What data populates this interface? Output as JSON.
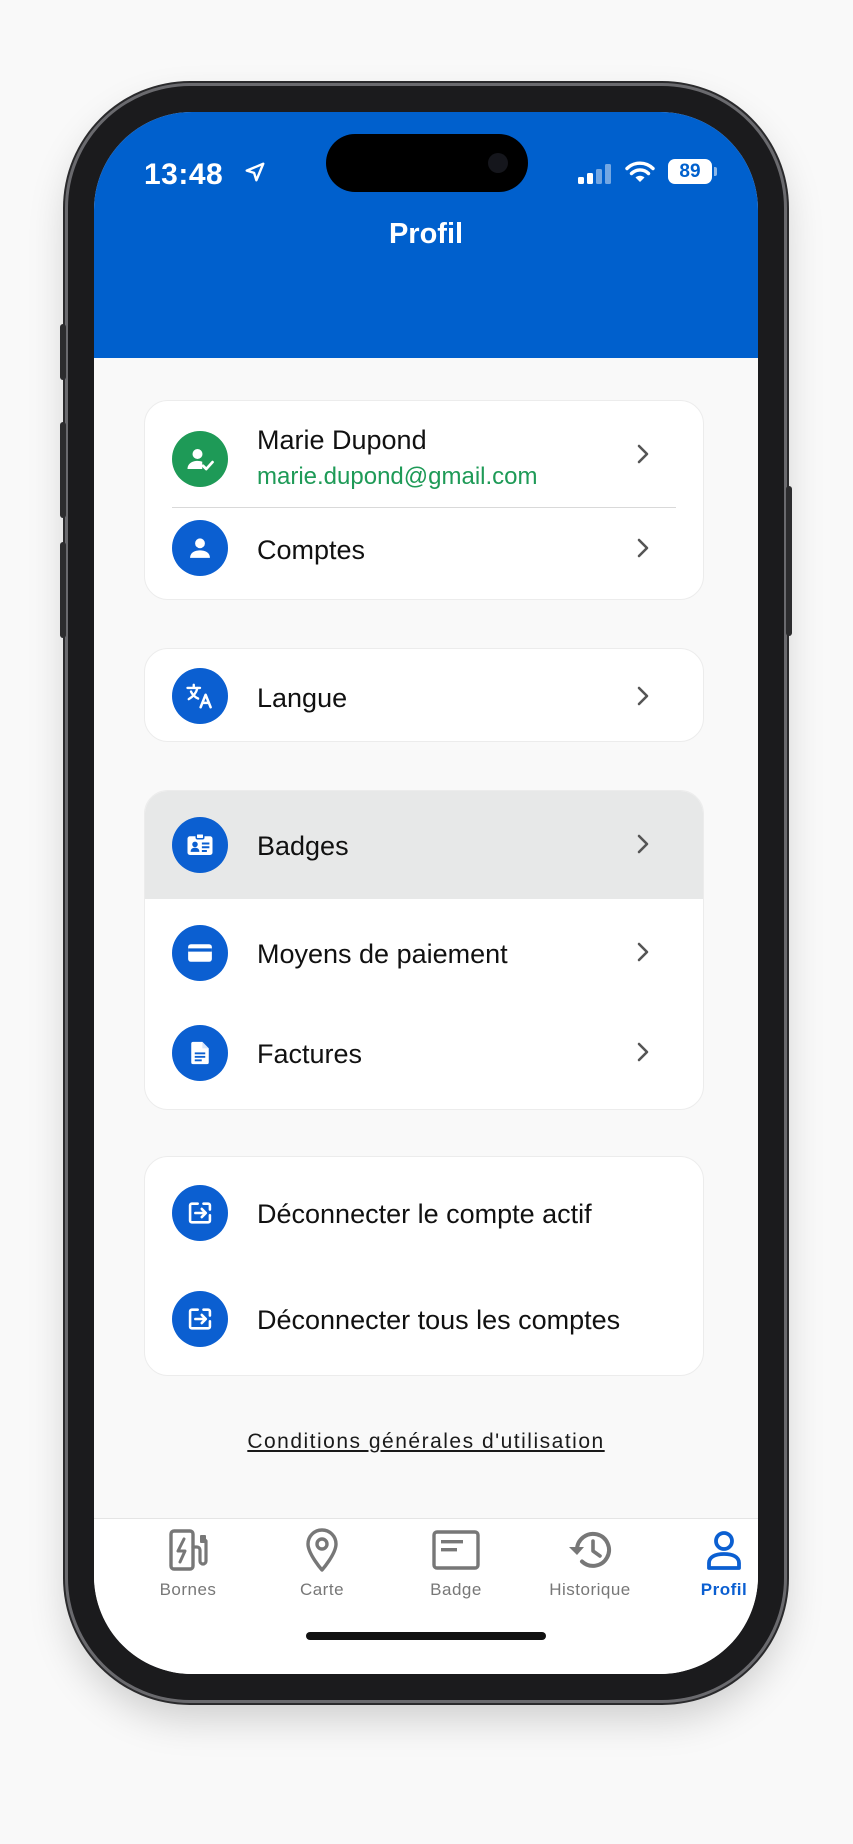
{
  "status_bar": {
    "time": "13:48",
    "battery": "89",
    "location_icon": "location-arrow-icon",
    "signal_icon": "cellular-signal-icon",
    "wifi_icon": "wifi-icon"
  },
  "header": {
    "title": "Profil"
  },
  "profile_card": {
    "user": {
      "name": "Marie Dupond",
      "email": "marie.dupond@gmail.com",
      "icon": "verified-user-icon"
    },
    "accounts": {
      "label": "Comptes",
      "icon": "person-icon"
    }
  },
  "language_card": {
    "label": "Langue",
    "icon": "translate-icon"
  },
  "payment_card": {
    "items": [
      {
        "label": "Badges",
        "icon": "badge-id-icon"
      },
      {
        "label": "Moyens de paiement",
        "icon": "credit-card-icon"
      },
      {
        "label": "Factures",
        "icon": "document-icon"
      }
    ]
  },
  "logout_card": {
    "items": [
      {
        "label": "Déconnecter le compte actif",
        "icon": "logout-icon"
      },
      {
        "label": "Déconnecter tous les comptes",
        "icon": "logout-icon"
      }
    ]
  },
  "terms_link": "Conditions générales d'utilisation",
  "tabbar": {
    "active": "Profil",
    "tabs": [
      {
        "label": "Bornes",
        "icon": "charging-station-icon"
      },
      {
        "label": "Carte",
        "icon": "map-pin-icon"
      },
      {
        "label": "Badge",
        "icon": "badge-card-icon"
      },
      {
        "label": "Historique",
        "icon": "history-icon"
      },
      {
        "label": "Profil",
        "icon": "profile-icon"
      }
    ]
  },
  "colors": {
    "primary": "#0060cd",
    "accent_green": "#1e9a57",
    "highlight_row": "#e7e8e8",
    "inactive_tab": "#777777"
  }
}
